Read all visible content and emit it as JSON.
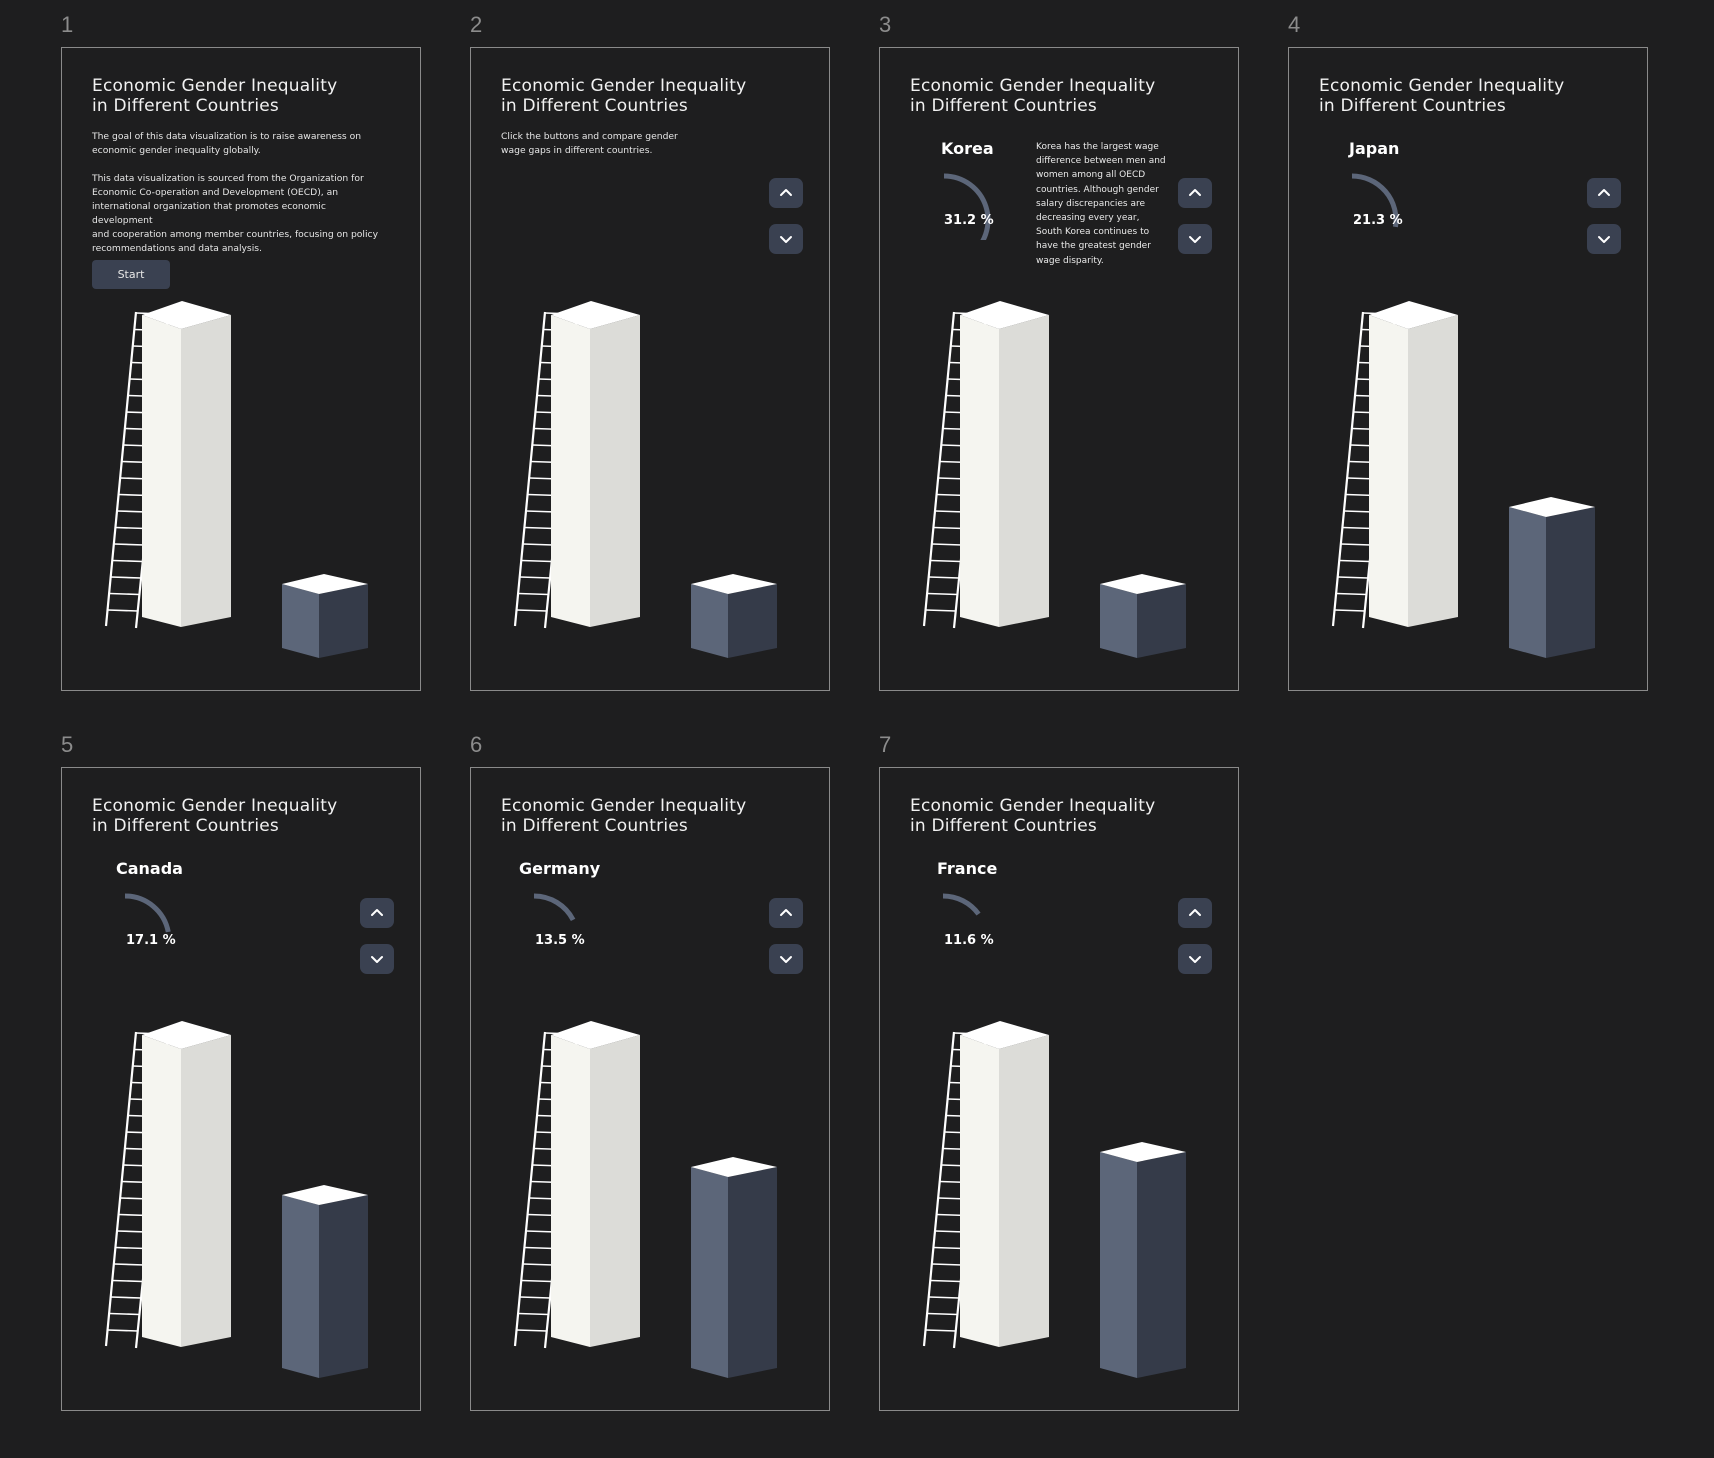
{
  "panels": [
    {
      "number": "1",
      "title": "Economic Gender Inequality\nin Different Countries",
      "intro": "The goal of this data visualization is to raise awareness on\neconomic gender inequality globally.",
      "source": "This data visualization is sourced from the Organization for\nEconomic Co-operation and Development (OECD), an\ninternational organization that promotes economic development\nand cooperation among member countries, focusing on policy\nrecommendations and data analysis.",
      "start_label": "Start",
      "dark_block_level": "initial"
    },
    {
      "number": "2",
      "title": "Economic Gender Inequality\nin Different Countries",
      "instruction": "Click the buttons and compare gender\nwage gaps in different countries.",
      "dark_block_level": "initial"
    },
    {
      "number": "3",
      "title": "Economic Gender Inequality\nin Different Countries",
      "country": "Korea",
      "gap_value": 31.2,
      "gap_label": "31.2 %",
      "description": "Korea has the largest wage difference between men and women among all OECD countries. Although gender salary discrepancies are decreasing every year, South Korea continues to have the greatest gender wage disparity."
    },
    {
      "number": "4",
      "title": "Economic Gender Inequality\nin Different Countries",
      "country": "Japan",
      "gap_value": 21.3,
      "gap_label": "21.3 %"
    },
    {
      "number": "5",
      "title": "Economic Gender Inequality\nin Different Countries",
      "country": "Canada",
      "gap_value": 17.1,
      "gap_label": "17.1 %"
    },
    {
      "number": "6",
      "title": "Economic Gender Inequality\nin Different Countries",
      "country": "Germany",
      "gap_value": 13.5,
      "gap_label": "13.5 %"
    },
    {
      "number": "7",
      "title": "Economic Gender Inequality\nin Different Countries",
      "country": "France",
      "gap_value": 11.6,
      "gap_label": "11.6 %"
    }
  ],
  "icons": {
    "up": "chevron-up-icon",
    "down": "chevron-down-icon"
  },
  "colors": {
    "background": "#1e1e1f",
    "button": "#3a4151",
    "gauge": "#5c6679",
    "block_front": "#5c6679",
    "block_side": "#353b49",
    "pillar_front": "#f5f5f0",
    "pillar_side": "#dcdcd8"
  }
}
